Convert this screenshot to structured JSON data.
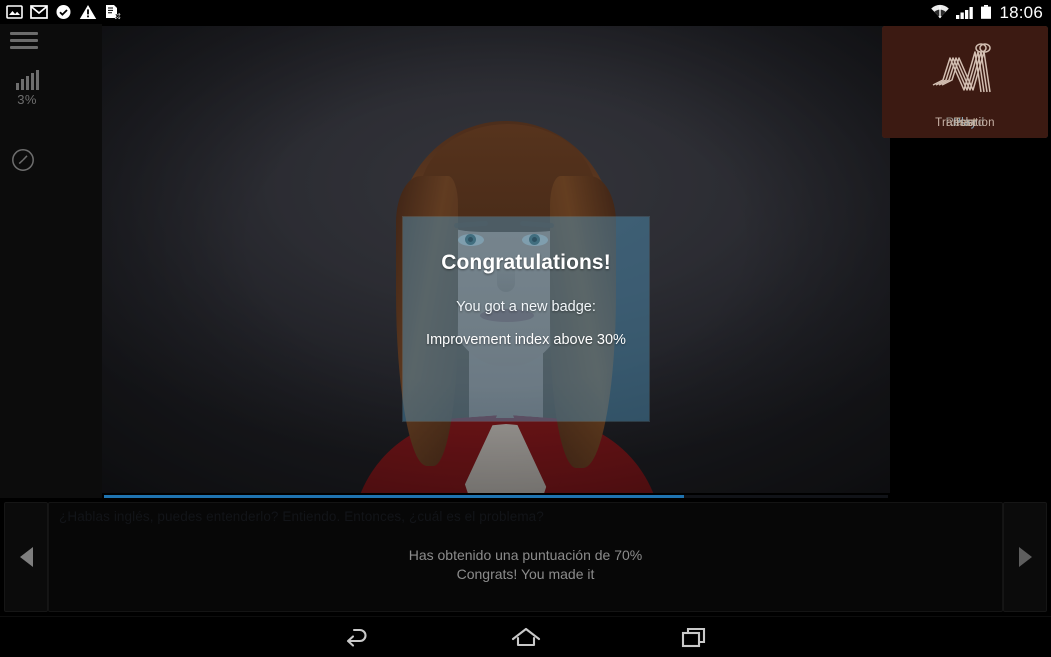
{
  "statusbar": {
    "time": "18:06",
    "left_icons": [
      "screenshot-icon",
      "gmail-icon",
      "check-circle-icon",
      "warning-icon",
      "file-error-icon"
    ],
    "right_icons": [
      "wifi-icon",
      "cellular-signal-icon",
      "battery-icon"
    ]
  },
  "rail": {
    "menu_icon": "hamburger-menu-icon",
    "stats_icon": "bar-chart-icon",
    "stats_value": "3%",
    "gauge_icon": "speedometer-icon"
  },
  "dialog": {
    "title": "Congratulations!",
    "subtitle": "You got a new badge:",
    "badge": "Improvement index above 30%",
    "overlay_color": "#5096be"
  },
  "progress": {
    "percent": 74,
    "color": "#1f73b0"
  },
  "actions": [
    {
      "label": "Play",
      "icon": "waveform-broadcast-icon",
      "color": "#064063"
    },
    {
      "label": "Record",
      "icon": "waveform-mic-icon",
      "color": "#10141d"
    },
    {
      "label": "Test",
      "icon": "waveform-striped-icon",
      "color": "#563c22"
    },
    {
      "label": "Translation",
      "icon": "waveform-layers-icon",
      "color": "#3c1a12"
    }
  ],
  "transcript": {
    "prev_icon": "chevron-left-icon",
    "next_icon": "chevron-right-icon",
    "faint_line": "¿Hablas inglés, puedes entenderlo? Entiendo. Entonces, ¿cuál es el problema?",
    "line1": "Has obtenido una puntuación de 70%",
    "line2": "Congrats! You made it"
  },
  "androidnav": {
    "back_label": "back-icon",
    "home_label": "home-icon",
    "recents_label": "recent-apps-icon"
  }
}
